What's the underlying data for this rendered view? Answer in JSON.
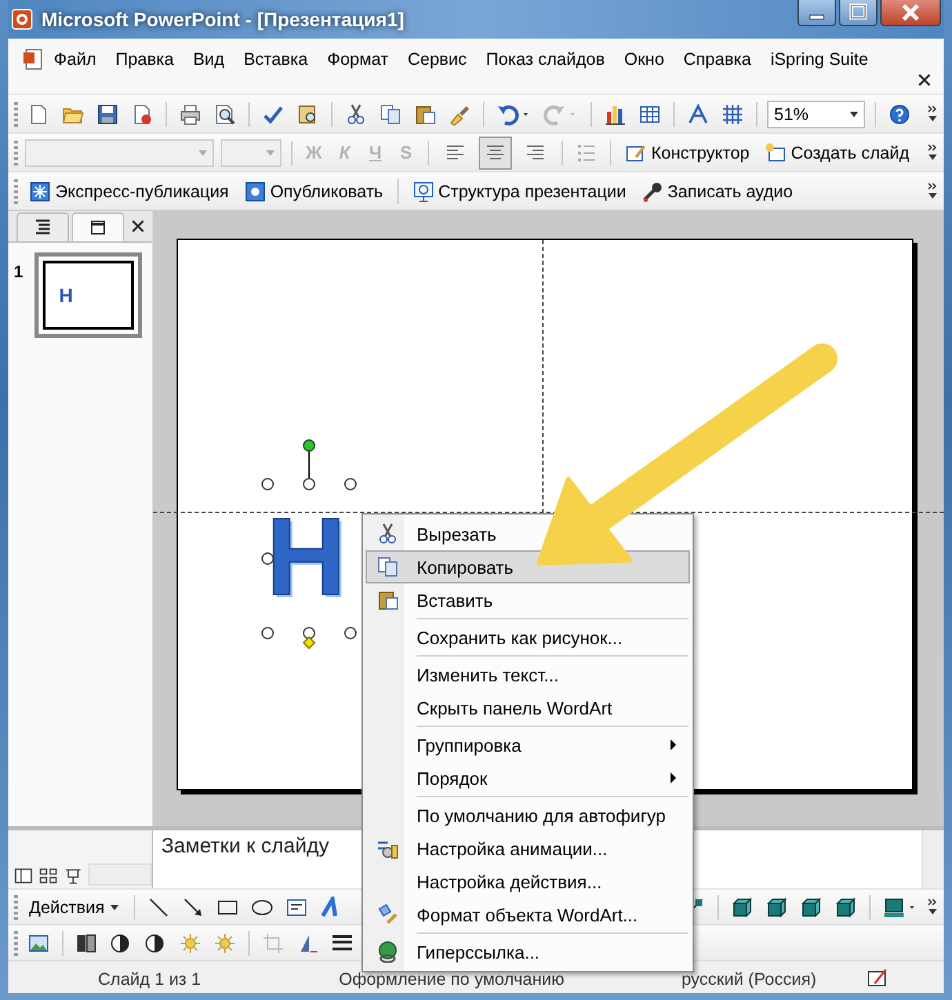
{
  "window": {
    "title": "Microsoft PowerPoint - [Презентация1]"
  },
  "menu_bar": [
    "Файл",
    "Правка",
    "Вид",
    "Вставка",
    "Формат",
    "Сервис",
    "Показ слайдов",
    "Окно",
    "Справка",
    "iSpring Suite"
  ],
  "standard_toolbar": {
    "zoom": "51%"
  },
  "formatting_toolbar": {
    "font_styles": [
      {
        "label": "Ж",
        "disabled": true
      },
      {
        "label": "К",
        "disabled": true
      },
      {
        "label": "Ч",
        "disabled": true
      },
      {
        "label": "S",
        "disabled": true
      }
    ],
    "alignment": [
      {
        "selected": false
      },
      {
        "selected": true
      },
      {
        "selected": false
      }
    ],
    "buttons": [
      "Конструктор",
      "Создать слайд"
    ]
  },
  "ispring_toolbar": {
    "buttons": [
      "Экспресс-публикация",
      "Опубликовать",
      "Структура презентации",
      "Записать аудио"
    ]
  },
  "side_pane": {
    "tabs": [
      {
        "selected": false
      },
      {
        "selected": true
      }
    ],
    "slides": [
      {
        "number": "1",
        "selected": true,
        "wordart": "Н"
      }
    ]
  },
  "slide": {
    "wordart": "Н"
  },
  "notes": {
    "placeholder": "Заметки к слайду"
  },
  "drawing_toolbar": {
    "actions": "Действия"
  },
  "context_menu": [
    {
      "label": "Вырезать",
      "selected": false,
      "separator_before": false,
      "submenu": false
    },
    {
      "label": "Копировать",
      "selected": true,
      "separator_before": false,
      "submenu": false
    },
    {
      "label": "Вставить",
      "selected": false,
      "separator_before": false,
      "submenu": false
    },
    {
      "label": "Сохранить как рисунок...",
      "selected": false,
      "separator_before": true,
      "submenu": false
    },
    {
      "label": "Изменить текст...",
      "selected": false,
      "separator_before": true,
      "submenu": false
    },
    {
      "label": "Скрыть панель WordArt",
      "selected": false,
      "separator_before": false,
      "submenu": false
    },
    {
      "label": "Группировка",
      "selected": false,
      "separator_before": true,
      "submenu": true
    },
    {
      "label": "Порядок",
      "selected": false,
      "separator_before": false,
      "submenu": true
    },
    {
      "label": "По умолчанию для автофигур",
      "selected": false,
      "separator_before": true,
      "submenu": false
    },
    {
      "label": "Настройка анимации...",
      "selected": false,
      "separator_before": false,
      "submenu": false
    },
    {
      "label": "Настройка действия...",
      "selected": false,
      "separator_before": false,
      "submenu": false
    },
    {
      "label": "Формат объекта WordArt...",
      "selected": false,
      "separator_before": false,
      "submenu": false
    },
    {
      "label": "Гиперссылка...",
      "selected": false,
      "separator_before": true,
      "submenu": false
    }
  ],
  "status_bar": [
    "Слайд 1 из 1",
    "Оформление по умолчанию",
    "русский (Россия)"
  ]
}
